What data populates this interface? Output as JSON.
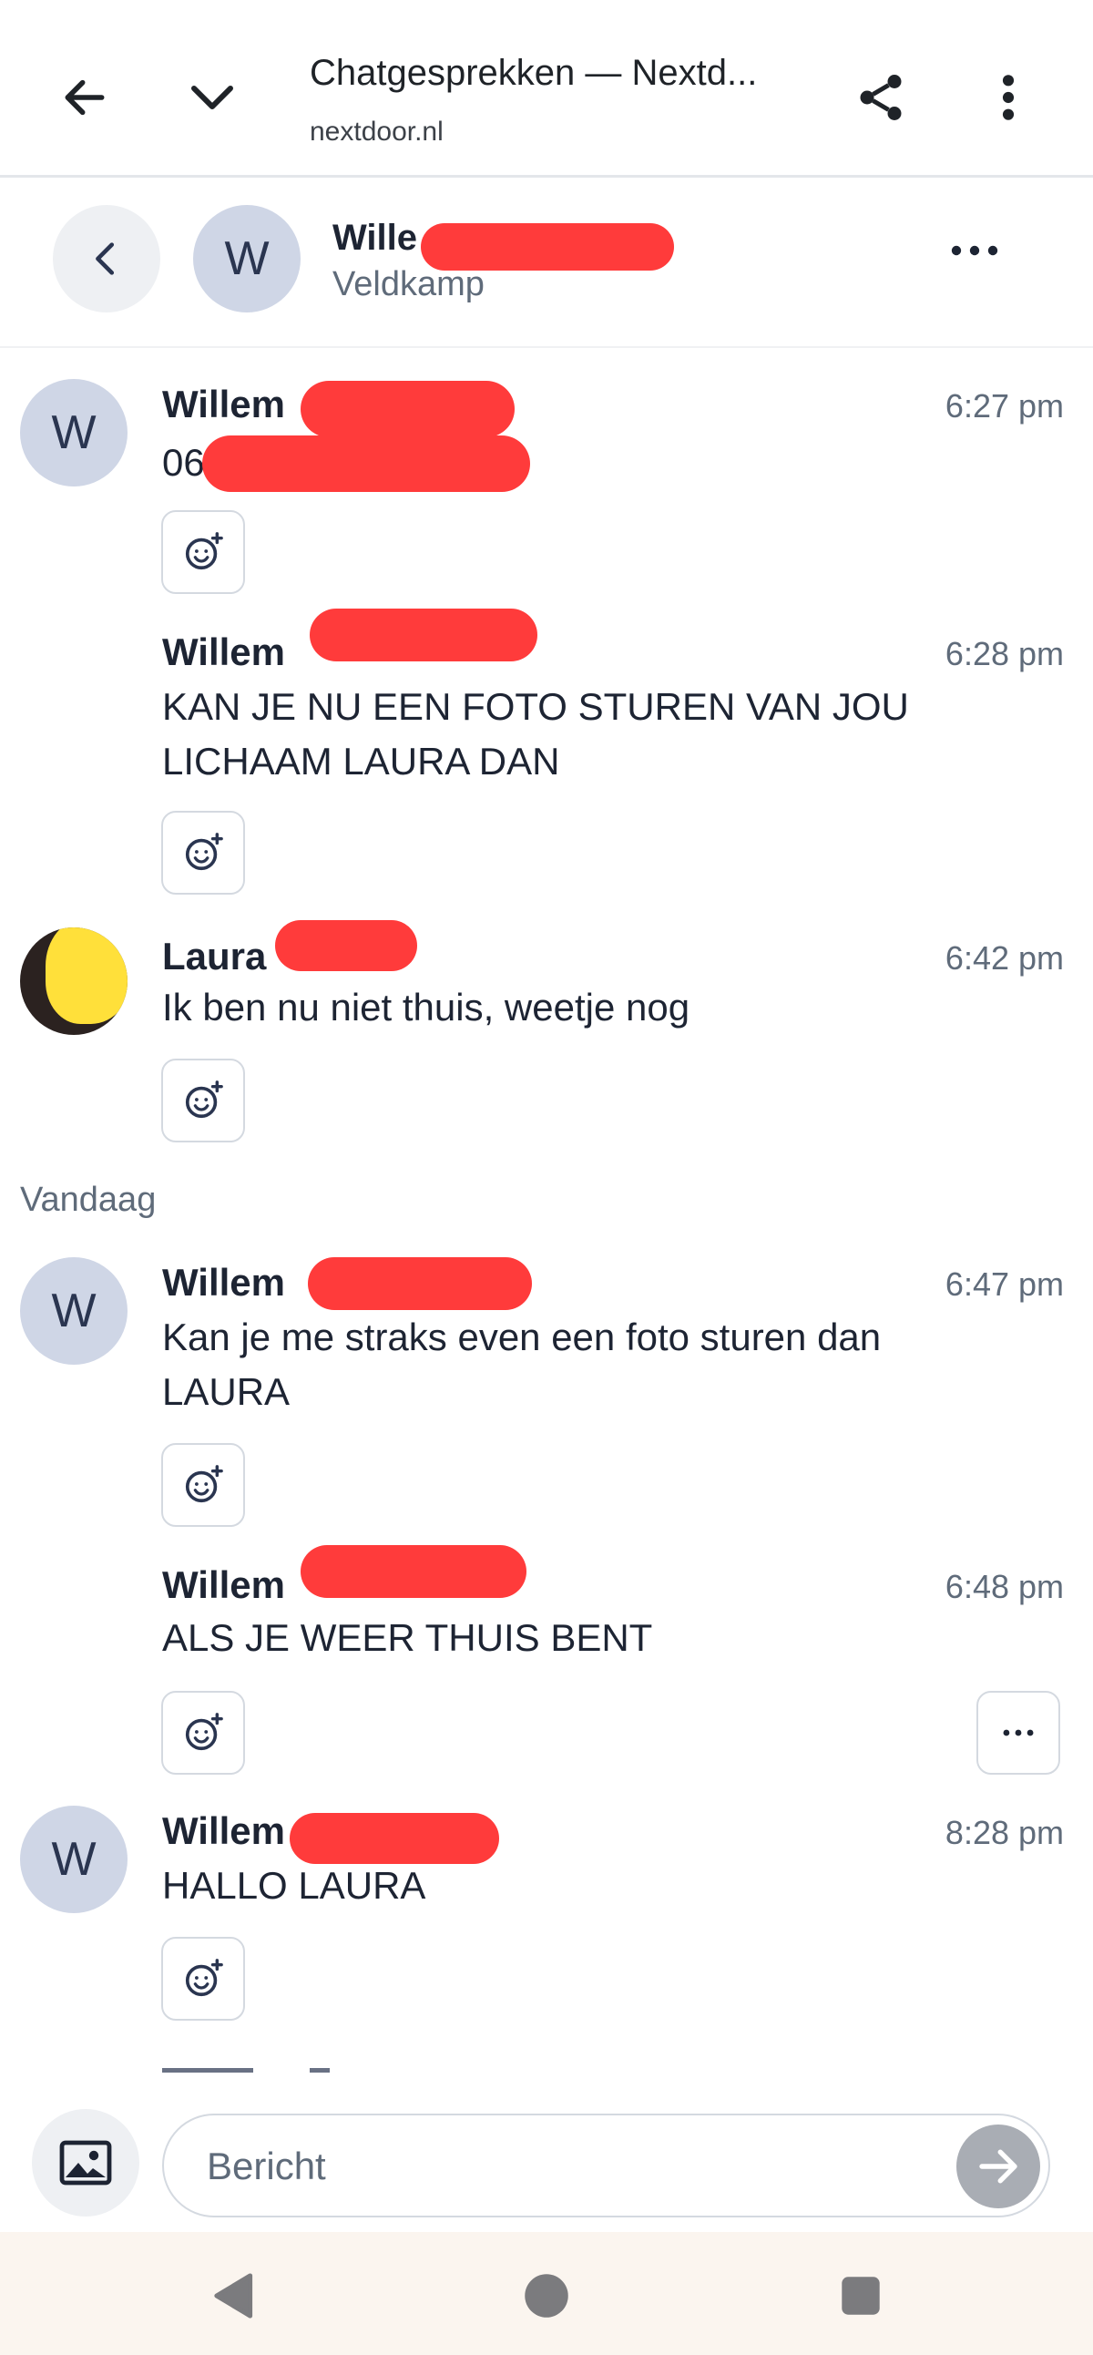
{
  "browser": {
    "title": "Chatgesprekken — Nextd...",
    "url": "nextdoor.nl"
  },
  "header": {
    "avatar_initial": "W",
    "name": "Wille",
    "subtitle": "Veldkamp"
  },
  "messages": [
    {
      "avatar": "W",
      "name": "Willem",
      "time": "6:27 pm",
      "text": "06"
    },
    {
      "avatar": "",
      "name": "Willem",
      "time": "6:28 pm",
      "text": "KAN JE NU EEN FOTO STUREN VAN JOU LICHAAM LAURA DAN"
    },
    {
      "avatar": "photo",
      "name": "Laura",
      "time": "6:42 pm",
      "text": "Ik ben nu niet thuis, weetje nog"
    },
    {
      "avatar": "W",
      "name": "Willem",
      "time": "6:47 pm",
      "text": "Kan je me straks even een foto sturen dan LAURA"
    },
    {
      "avatar": "",
      "name": "Willem",
      "time": "6:48 pm",
      "text": "ALS JE WEER THUIS BENT"
    },
    {
      "avatar": "W",
      "name": "Willem",
      "time": "8:28 pm",
      "text": "HALLO LAURA"
    }
  ],
  "day_separator": "Vandaag",
  "composer": {
    "placeholder": "Bericht"
  },
  "colors": {
    "redaction": "#ff3b3b",
    "avatar_bg": "#cfd6e6",
    "send_button": "#a9adb4",
    "muted_text": "#5f6b7a"
  },
  "icons": [
    "back-arrow-icon",
    "chevron-down-icon",
    "share-icon",
    "more-vertical-icon",
    "chevron-left-icon",
    "more-horizontal-icon",
    "add-reaction-icon",
    "image-icon",
    "arrow-right-icon",
    "nav-back-icon",
    "nav-home-icon",
    "nav-recents-icon"
  ]
}
